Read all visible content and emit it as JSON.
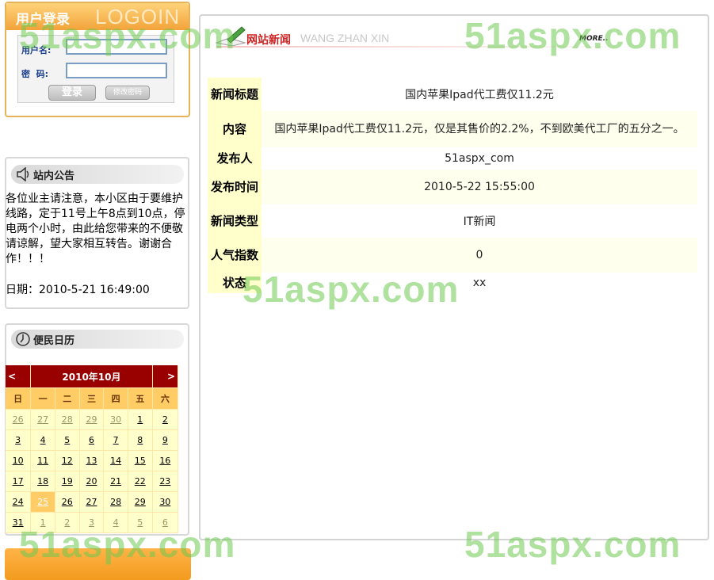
{
  "login": {
    "title": "用户登录",
    "title_en": "LOGOIN",
    "username_label": "用户名:",
    "password_label": "密  码:",
    "login_button": "登录",
    "change_password_button": "修改密码"
  },
  "notice": {
    "title": "站内公告",
    "body": "各位业主请注意，本小区由于要维护线路，定于11号上午8点到10点，停电两个小时，由此给您带来的不便敬请谅解，望大家相互转告。谢谢合作！！！",
    "date": "日期：2010-5-21 16:49:00"
  },
  "calendar": {
    "title": "便民日历",
    "prev": "<",
    "next": ">",
    "month_label": "2010年10月",
    "weekdays": [
      "日",
      "一",
      "二",
      "三",
      "四",
      "五",
      "六"
    ],
    "weeks": [
      [
        "26",
        "27",
        "28",
        "29",
        "30",
        "1",
        "2"
      ],
      [
        "3",
        "4",
        "5",
        "6",
        "7",
        "8",
        "9"
      ],
      [
        "10",
        "11",
        "12",
        "13",
        "14",
        "15",
        "16"
      ],
      [
        "17",
        "18",
        "19",
        "20",
        "21",
        "22",
        "23"
      ],
      [
        "24",
        "25",
        "26",
        "27",
        "28",
        "29",
        "30"
      ],
      [
        "31",
        "1",
        "2",
        "3",
        "4",
        "5",
        "6"
      ]
    ],
    "selected_day": "25"
  },
  "news": {
    "header": "网站新闻",
    "header_en": "WANG ZHAN XIN",
    "more": "MORE..",
    "rows": [
      {
        "key": "新闻标题",
        "value": "国内苹果Ipad代工费仅11.2元"
      },
      {
        "key": "内容",
        "value": "国内苹果Ipad代工费仅11.2元，仅是其售价的2.2%，不到欧美代工厂的五分之一。"
      },
      {
        "key": "发布人",
        "value": "51aspx_com"
      },
      {
        "key": "发布时间",
        "value": "2010-5-22 15:55:00"
      },
      {
        "key": "新闻类型",
        "value": "IT新闻"
      },
      {
        "key": "人气指数",
        "value": "0"
      },
      {
        "key": "状态",
        "value": "xx"
      }
    ]
  },
  "watermark": "51aspx.com",
  "colors": {
    "accent_orange": "#f2a33a",
    "calendar_header": "#990000",
    "calendar_weekday": "#ffcc66",
    "calendar_day": "#ffffcc",
    "news_title_red": "#cc2222",
    "watermark_green": "#6ec850"
  }
}
